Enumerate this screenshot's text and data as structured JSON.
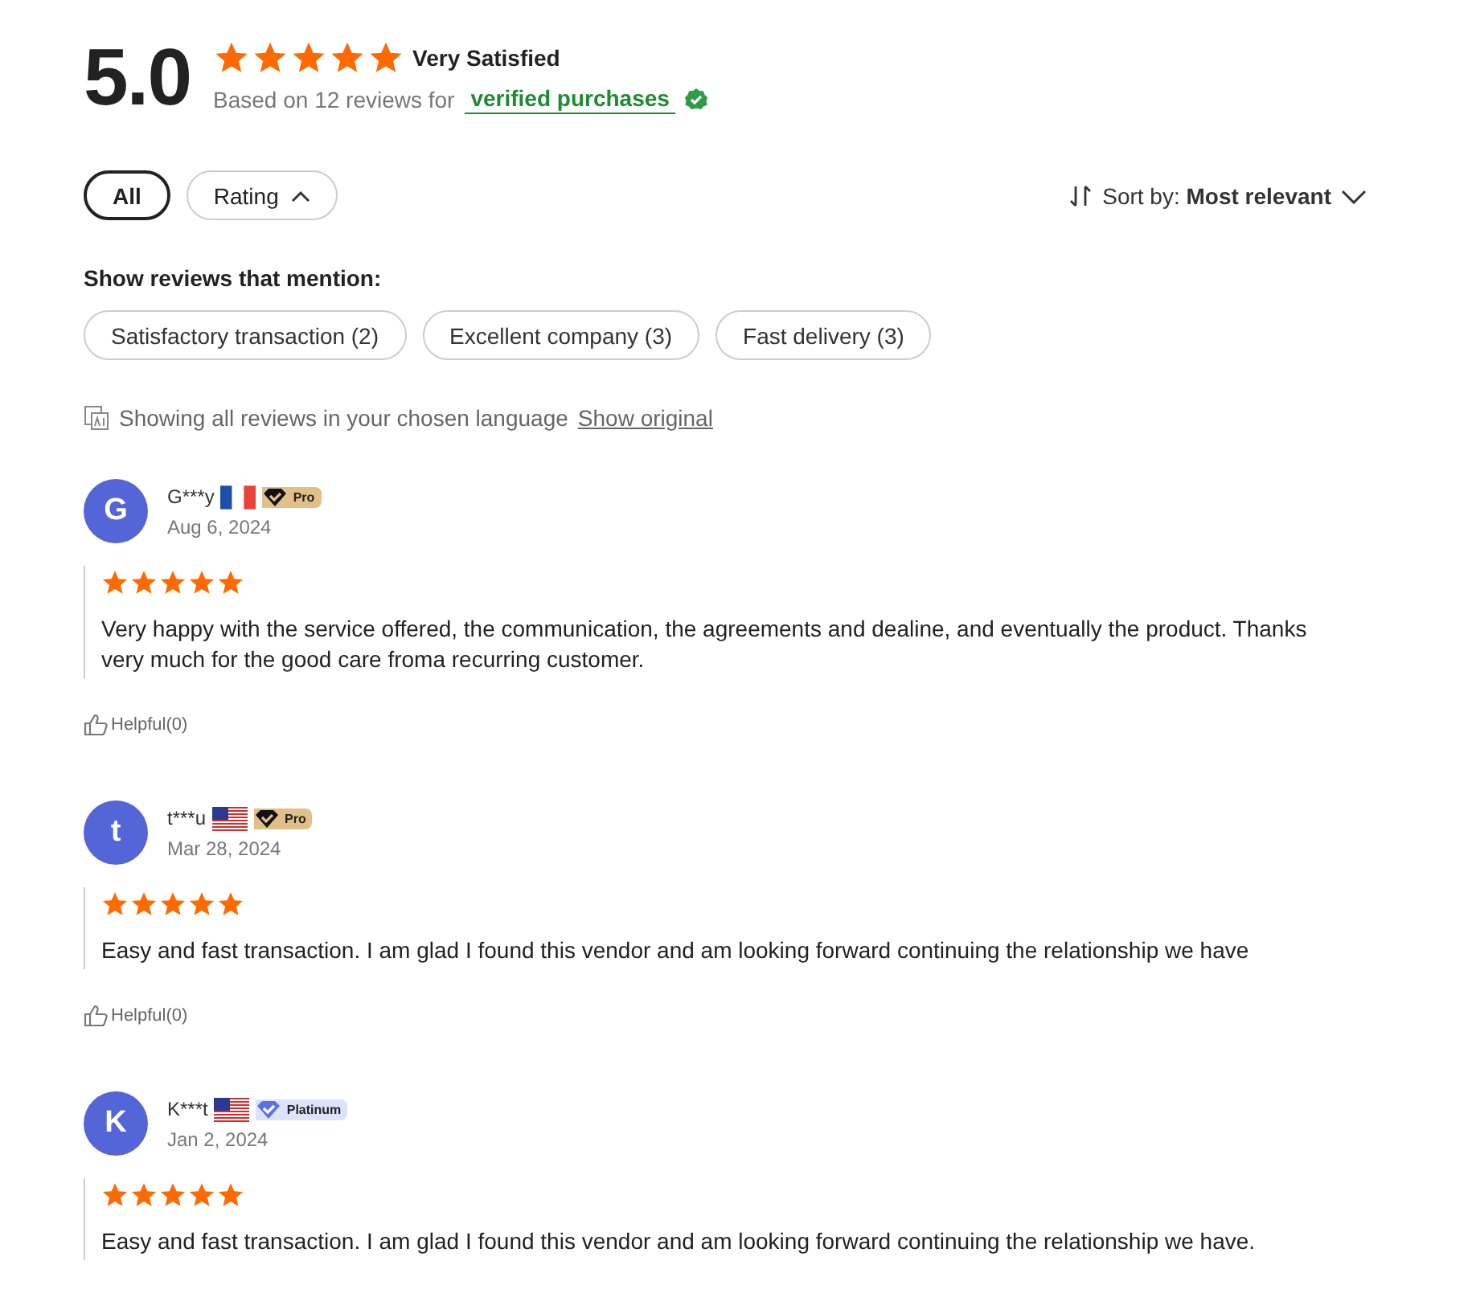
{
  "summary": {
    "score": "5.0",
    "stars": 5,
    "label": "Very Satisfied",
    "based_on": "Based on 12 reviews for",
    "verified_link": "verified purchases"
  },
  "filters": [
    {
      "label": "All",
      "selected": true,
      "kind": "plain"
    },
    {
      "label": "Rating",
      "selected": false,
      "kind": "dropdown"
    }
  ],
  "sort": {
    "label": "Sort by:",
    "value": "Most relevant"
  },
  "mentions": {
    "title": "Show reviews that mention:",
    "tags": [
      {
        "label": "Satisfactory transaction (2)"
      },
      {
        "label": "Excellent company (3)"
      },
      {
        "label": "Fast delivery (3)"
      }
    ]
  },
  "language_note": {
    "text": "Showing all reviews in your chosen language",
    "link": "Show original"
  },
  "reviews": [
    {
      "initial": "G",
      "name": "G***y",
      "flag": {
        "kind": "fr"
      },
      "badge": {
        "kind": "pro",
        "label": "Pro"
      },
      "date": "Aug 6, 2024",
      "stars": 5,
      "text": "Very happy with the service offered, the communication, the agreements and dealine, and eventually the product. Thanks very much for the good care froma recurring customer.",
      "helpful": "Helpful(0)"
    },
    {
      "initial": "t",
      "name": "t***u",
      "flag": {
        "kind": "us"
      },
      "badge": {
        "kind": "pro",
        "label": "Pro"
      },
      "date": "Mar 28, 2024",
      "stars": 5,
      "text": "Easy and fast transaction. I am glad I found this vendor and am looking forward continuing the relationship we have",
      "helpful": "Helpful(0)"
    },
    {
      "initial": "K",
      "name": "K***t",
      "flag": {
        "kind": "us"
      },
      "badge": {
        "kind": "platinum",
        "label": "Platinum"
      },
      "date": "Jan 2, 2024",
      "stars": 5,
      "text": "Easy and fast transaction. I am glad I found this vendor and am looking forward continuing the relationship we have."
    }
  ]
}
